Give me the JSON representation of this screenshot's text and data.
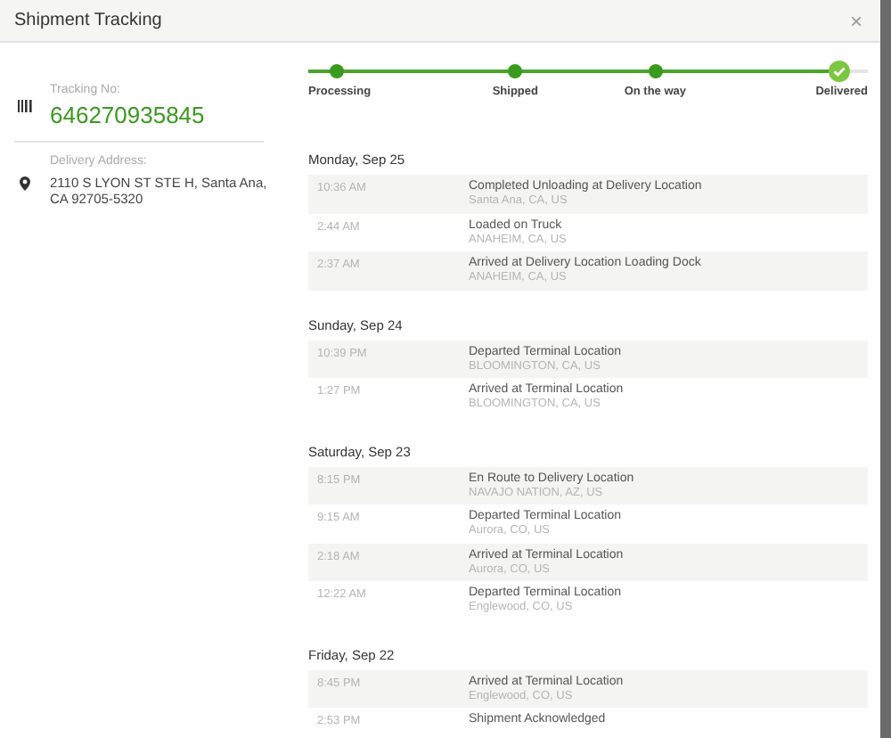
{
  "window": {
    "title": "Shipment Tracking",
    "close": "×"
  },
  "tracking": {
    "label": "Tracking No:",
    "number": "646270935845"
  },
  "delivery": {
    "label": "Delivery Address:",
    "address": "2110 S LYON ST STE H, Santa Ana, CA 92705-5320"
  },
  "progress": {
    "level": 0.95,
    "steps": [
      {
        "label": "Processing",
        "completed": true,
        "current": false
      },
      {
        "label": "Shipped",
        "completed": true,
        "current": false
      },
      {
        "label": "On the way",
        "completed": true,
        "current": false
      },
      {
        "label": "Delivered",
        "completed": true,
        "current": true
      }
    ]
  },
  "days": [
    {
      "date": "Monday, Sep 25",
      "events": [
        {
          "time": "10:36 AM",
          "event": "Completed Unloading at Delivery Location",
          "location": "Santa Ana, CA, US"
        },
        {
          "time": "2:44 AM",
          "event": "Loaded on Truck",
          "location": "ANAHEIM, CA, US"
        },
        {
          "time": "2:37 AM",
          "event": "Arrived at Delivery Location Loading Dock",
          "location": "ANAHEIM, CA, US"
        }
      ]
    },
    {
      "date": "Sunday, Sep 24",
      "events": [
        {
          "time": "10:39 PM",
          "event": "Departed Terminal Location",
          "location": "BLOOMINGTON, CA, US"
        },
        {
          "time": "1:27 PM",
          "event": "Arrived at Terminal Location",
          "location": "BLOOMINGTON, CA, US"
        }
      ]
    },
    {
      "date": "Saturday, Sep 23",
      "events": [
        {
          "time": "8:15 PM",
          "event": "En Route to Delivery Location",
          "location": "NAVAJO NATION, AZ, US"
        },
        {
          "time": "9:15 AM",
          "event": "Departed Terminal Location",
          "location": "Aurora, CO, US"
        },
        {
          "time": "2:18 AM",
          "event": "Arrived at Terminal Location",
          "location": "Aurora, CO, US"
        },
        {
          "time": "12:22 AM",
          "event": "Departed Terminal Location",
          "location": "Englewood, CO, US"
        }
      ]
    },
    {
      "date": "Friday, Sep 22",
      "events": [
        {
          "time": "8:45 PM",
          "event": "Arrived at Terminal Location",
          "location": "Englewood, CO, US"
        },
        {
          "time": "2:53 PM",
          "event": "Shipment Acknowledged"
        }
      ]
    }
  ]
}
